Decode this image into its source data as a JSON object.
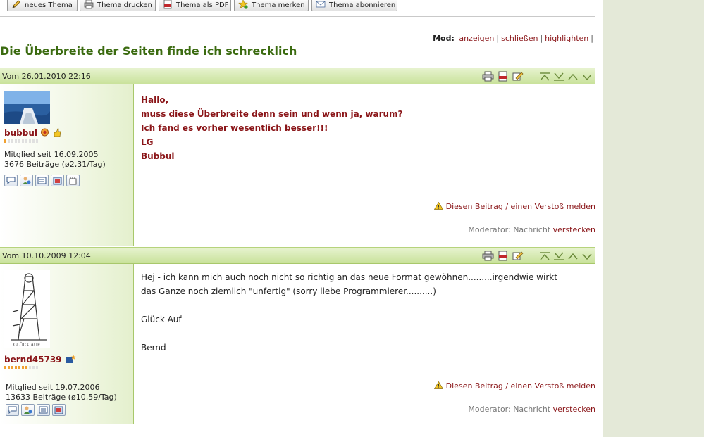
{
  "toolbar": {
    "buttons": [
      {
        "label": "neues Thema",
        "icon": "pencil-icon"
      },
      {
        "label": "Thema drucken",
        "icon": "printer-icon"
      },
      {
        "label": "Thema als PDF",
        "icon": "pdf-icon"
      },
      {
        "label": "Thema merken",
        "icon": "star-add-icon"
      },
      {
        "label": "Thema abonnieren",
        "icon": "envelope-icon"
      }
    ]
  },
  "mod": {
    "label": "Mod:",
    "links": [
      "anzeigen",
      "schließen",
      "highlighten"
    ],
    "separator": "|"
  },
  "thread_title": "Die Überbreite der Seiten finde ich schrecklich",
  "posts": [
    {
      "date": "Vom 26.01.2010 22:16",
      "username": "bubbul",
      "member_since": "Mitglied seit 16.09.2005",
      "post_count": "3676 Beiträge (ø2,31/Tag)",
      "rank_filled": 1,
      "rank_total": 10,
      "lines": [
        "Hallo,",
        "muss diese Überbreite denn sein und wenn ja, warum?",
        "Ich fand es vorher wesentlich besser!!!",
        "LG",
        "Bubbul"
      ],
      "report": "Diesen Beitrag / einen Verstoß melden",
      "moderator_prefix": "Moderator: Nachricht",
      "moderator_link": "verstecken"
    },
    {
      "date": "Vom 10.10.2009 12:04",
      "username": "bernd45739",
      "member_since": "Mitglied seit 19.07.2006",
      "post_count": "13633 Beiträge (ø10,59/Tag)",
      "avatar_text": "GLÜCK AUF",
      "rank_filled": 7,
      "rank_total": 10,
      "lines": [
        "Hej - ich kann mich auch noch nicht so richtig an das neue Format gewöhnen.........irgendwie wirkt",
        "das Ganze noch ziemlich \"unfertig\" (sorry liebe Programmierer..........)",
        "",
        "Glück Auf",
        "",
        "Bernd"
      ],
      "report": "Diesen Beitrag / einen Verstoß melden",
      "moderator_prefix": "Moderator: Nachricht",
      "moderator_link": "verstecken"
    }
  ],
  "colors": {
    "accent_red": "#8a1518",
    "title_green": "#3b6b10",
    "header_green": "#c9e29b",
    "sidebar_right": "#e4e9d8"
  }
}
